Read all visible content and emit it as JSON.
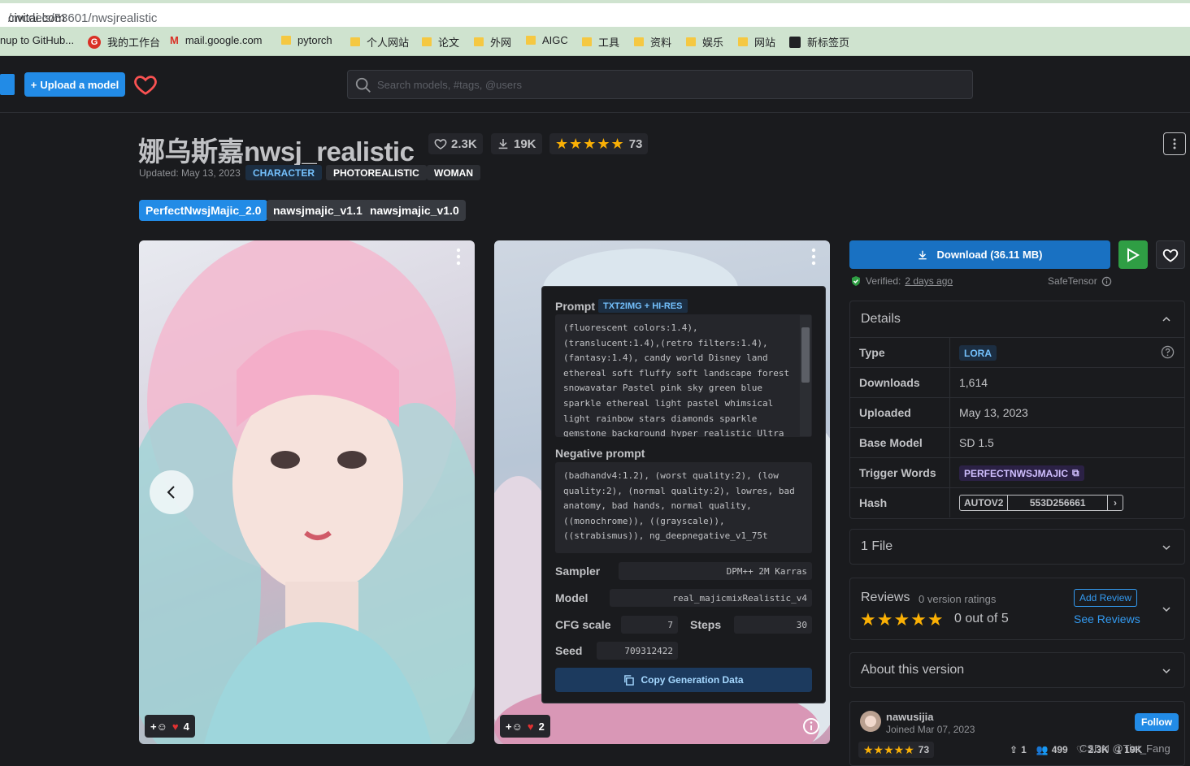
{
  "browser": {
    "url_domain": "civitai.com",
    "url_path": "/models/53601/nwsjrealistic",
    "bookmarks": [
      "nup to GitHub...",
      "我的工作台",
      "mail.google.com",
      "pytorch",
      "个人网站",
      "论文",
      "外网",
      "AIGC",
      "工具",
      "资料",
      "娱乐",
      "网站",
      "新标签页"
    ]
  },
  "header": {
    "upload_label": "Upload a model",
    "search_placeholder": "Search models, #tags, @users"
  },
  "model": {
    "title": "娜乌斯嘉nwsj_realistic",
    "likes": "2.3K",
    "downloads": "19K",
    "rating_count": "73",
    "updated": "Updated: May 13, 2023",
    "tags": [
      "CHARACTER",
      "PHOTOREALISTIC",
      "WOMAN"
    ],
    "versions": [
      "PerfectNwsjMajic_2.0",
      "nawsjmajic_v1.1",
      "nawsjmajic_v1.0"
    ]
  },
  "images": [
    {
      "reactions": "4"
    },
    {
      "reactions": "2"
    }
  ],
  "generation": {
    "prompt_label": "Prompt",
    "prompt_badge": "TXT2IMG + HI-RES",
    "prompt": "(fluorescent colors:1.4),\n(translucent:1.4),(retro filters:1.4),\n(fantasy:1.4), candy world Disney land\nethereal soft fluffy soft landscape forest\nsnowavatar Pastel pink sky green blue\nsparkle ethereal light pastel whimsical\nlight rainbow stars diamonds sparkle\ngemstone background hyper realistic Ultra",
    "negative_label": "Negative prompt",
    "negative": "(badhandv4:1.2), (worst quality:2), (low\nquality:2), (normal quality:2), lowres, bad\nanatomy, bad hands, normal quality,\n((monochrome)), ((grayscale)),\n((strabismus)), ng_deepnegative_v1_75t",
    "sampler_label": "Sampler",
    "sampler": "DPM++ 2M Karras",
    "model_label": "Model",
    "model": "real_majicmixRealistic_v4",
    "cfg_label": "CFG scale",
    "cfg": "7",
    "steps_label": "Steps",
    "steps": "30",
    "seed_label": "Seed",
    "seed": "709312422",
    "copy_label": "Copy Generation Data"
  },
  "sidebar": {
    "download_label": "Download (36.11 MB)",
    "verified_prefix": "Verified:",
    "verified_when": "2 days ago",
    "safetensor": "SafeTensor",
    "details_title": "Details",
    "details": {
      "type_key": "Type",
      "type_val": "LORA",
      "downloads_key": "Downloads",
      "downloads_val": "1,614",
      "uploaded_key": "Uploaded",
      "uploaded_val": "May 13, 2023",
      "base_key": "Base Model",
      "base_val": "SD 1.5",
      "trigger_key": "Trigger Words",
      "trigger_val": "PERFECTNWSJMAJIC",
      "hash_key": "Hash",
      "hash_type": "AUTOV2",
      "hash_val": "553D256661"
    },
    "files_title": "1 File",
    "reviews_title": "Reviews",
    "reviews_count": "0 version ratings",
    "reviews_score": "0 out of 5",
    "add_review": "Add Review",
    "see_reviews": "See Reviews",
    "about_title": "About this version",
    "creator": {
      "name": "nawusijia",
      "joined": "Joined Mar 07, 2023",
      "follow": "Follow",
      "rating_count": "73",
      "uploads": "1",
      "followers": "499",
      "likes": "2.3K",
      "downloads": "19K"
    }
  },
  "watermark": "CSDN @Tiat_Fang"
}
